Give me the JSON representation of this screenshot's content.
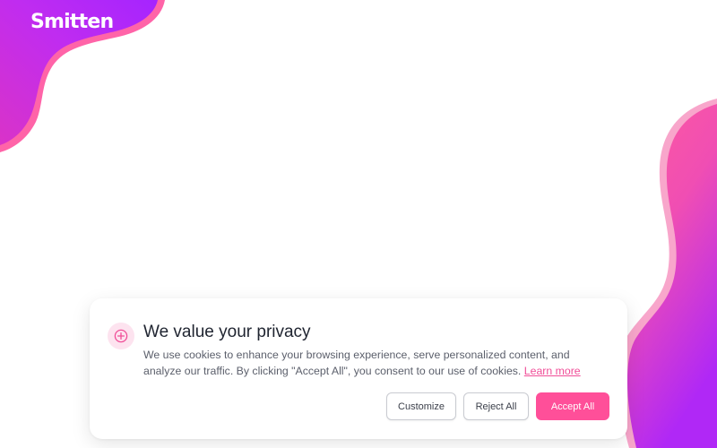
{
  "brand": {
    "logo_text": "Smitten"
  },
  "cookie_banner": {
    "icon": "circle-plus-icon",
    "title": "We value your privacy",
    "body_text": "We use cookies to enhance your browsing experience, serve personalized content, and analyze our traffic. By clicking \"Accept All\", you consent to our use of cookies.",
    "learn_more_label": "Learn more",
    "buttons": {
      "customize_label": "Customize",
      "reject_label": "Reject All",
      "accept_label": "Accept All"
    }
  },
  "colors": {
    "accent_pink": "#ff4f99",
    "gradient_pink": "#ff5b9e",
    "gradient_purple": "#b027ff",
    "icon_background": "#fde3ef",
    "link": "#f04e98"
  }
}
